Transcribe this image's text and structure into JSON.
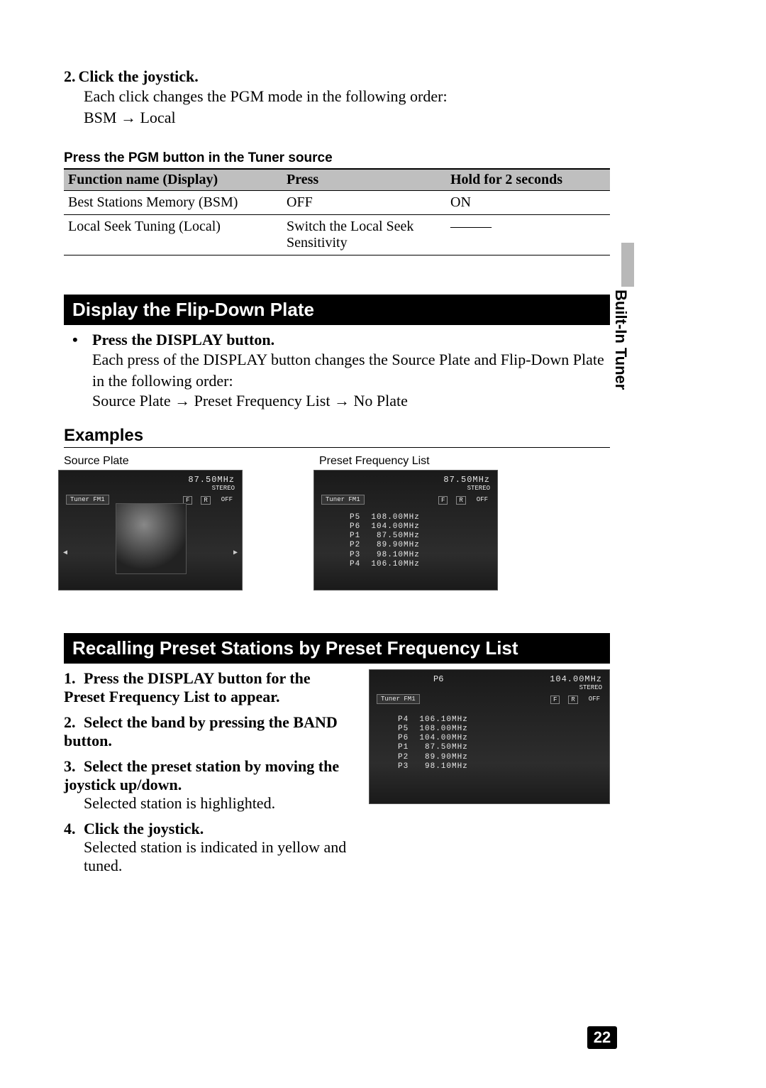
{
  "sidebar_label": "Built-In Tuner",
  "page_number": "22",
  "step2": {
    "num": "2.",
    "title": "Click the joystick.",
    "body_line1": "Each click changes the PGM mode in the following order:",
    "body_line2a": "BSM",
    "body_line2b": "Local"
  },
  "pgm_table": {
    "caption": "Press the PGM button in the Tuner source",
    "headers": {
      "c1": "Function name (Display)",
      "c2": "Press",
      "c3": "Hold for 2 seconds"
    },
    "rows": [
      {
        "c1": "Best Stations Memory (BSM)",
        "c2": "OFF",
        "c3": "ON"
      },
      {
        "c1": "Local Seek Tuning (Local)",
        "c2": "Switch the Local Seek Sensitivity",
        "c3": "———"
      }
    ]
  },
  "section_flip": {
    "title": "Display the Flip-Down Plate",
    "bullet_title": "Press the DISPLAY button.",
    "body_line1": "Each press of the DISPLAY button changes the Source Plate and Flip-Down Plate in the following order:",
    "seq1": "Source Plate",
    "seq2": "Preset Frequency List",
    "seq3": "No Plate"
  },
  "examples": {
    "header": "Examples",
    "label1": "Source Plate",
    "label2": "Preset Frequency List",
    "screen_common": {
      "freq": "87.50MHz",
      "stereo": "STEREO",
      "tuner": "Tuner FM1",
      "icon1": "F",
      "icon2": "R",
      "off": "OFF"
    },
    "preset_list": "P5  108.00MHz\nP6  104.00MHz\nP1   87.50MHz\nP2   89.90MHz\nP3   98.10MHz\nP4  106.10MHz"
  },
  "section_recall": {
    "title": "Recalling Preset Stations by Preset Frequency List",
    "items": [
      {
        "num": "1.",
        "title": "Press the DISPLAY button for the Preset Frequency List to appear.",
        "body": ""
      },
      {
        "num": "2.",
        "title": "Select the band by pressing the BAND button.",
        "body": ""
      },
      {
        "num": "3.",
        "title": "Select the preset station by moving the joystick up/down.",
        "body": "Selected station is highlighted."
      },
      {
        "num": "4.",
        "title": "Click the joystick.",
        "body": "Selected station is indicated in yellow and tuned."
      }
    ],
    "screen": {
      "p6": "P6",
      "freq": "104.00MHz",
      "stereo": "STEREO",
      "tuner": "Tuner FM1",
      "icon1": "F",
      "icon2": "R",
      "off": "OFF",
      "presets": "P4  106.10MHz\nP5  108.00MHz\nP6  104.00MHz\nP1   87.50MHz\nP2   89.90MHz\nP3   98.10MHz"
    }
  }
}
